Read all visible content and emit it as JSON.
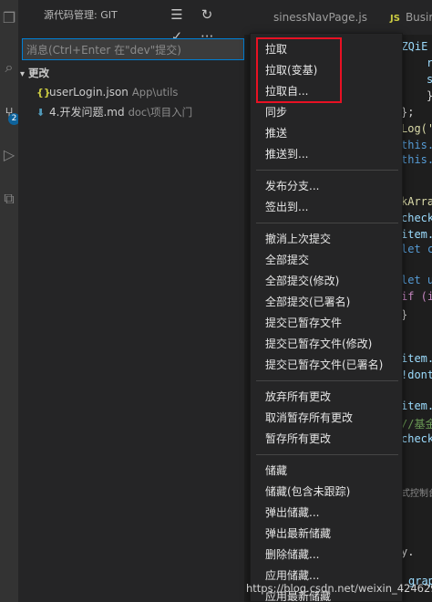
{
  "activity_badge": "2",
  "sidebar": {
    "title": "源代码管理: GIT",
    "commit_placeholder": "消息(Ctrl+Enter 在\"dev\"提交)",
    "group_label": "更改",
    "files": [
      {
        "icon": "{}",
        "name": "userLogin.json",
        "path": "App\\utils"
      },
      {
        "icon": "⬇",
        "name": "4.开发问题.md",
        "path": "doc\\项目入门"
      }
    ]
  },
  "tabs": [
    {
      "label": "sinessNavPage.js"
    },
    {
      "icon": "JS",
      "label": "Busir"
    }
  ],
  "editor": {
    "lines": [
      {
        "text": "ITZQiE",
        "color": "#9cdcfe"
      },
      {
        "text": "r",
        "color": "#9cdcfe"
      },
      {
        "text": "s",
        "color": "#9cdcfe"
      },
      {
        "text": "}",
        "color": "#d4d4d4"
      },
      {
        "text": "};",
        "color": "#d4d4d4"
      },
      {
        "text": "Log('",
        "color": "#dcdcaa"
      },
      {
        "text": "this.",
        "color": "#569cd6"
      },
      {
        "text": "this.",
        "color": "#569cd6"
      },
      {
        "text": "kArra",
        "color": "#dcdcaa"
      },
      {
        "text": "check",
        "color": "#9cdcfe"
      },
      {
        "text": "item.",
        "color": "#9cdcfe"
      },
      {
        "text": "let c",
        "color": "#569cd6"
      },
      {
        "text": "let u",
        "color": "#569cd6"
      },
      {
        "text": "if (i",
        "color": "#c586c0"
      },
      {
        "text": "}",
        "color": "#d4d4d4"
      },
      {
        "text": "item.",
        "color": "#9cdcfe"
      },
      {
        "text": "!dont",
        "color": "#9cdcfe"
      },
      {
        "text": "item.a",
        "color": "#9cdcfe"
      },
      {
        "text": "//基金",
        "color": "#6a9955"
      },
      {
        "text": "check",
        "color": "#9cdcfe"
      },
      {
        "text": "式控制台",
        "color": "#8c8c8c"
      },
      {
        "text": "y.",
        "color": "#d4d4d4"
      },
      {
        "text": "grap",
        "color": "#9cdcfe"
      }
    ]
  },
  "menu": {
    "groups": [
      [
        "拉取",
        "拉取(变基)",
        "拉取自...",
        "同步",
        "推送",
        "推送到..."
      ],
      [
        "发布分支...",
        "签出到..."
      ],
      [
        "撤消上次提交",
        "全部提交",
        "全部提交(修改)",
        "全部提交(已署名)",
        "提交已暂存文件",
        "提交已暂存文件(修改)",
        "提交已暂存文件(已署名)"
      ],
      [
        "放弃所有更改",
        "取消暂存所有更改",
        "暂存所有更改"
      ],
      [
        "储藏",
        "储藏(包含未跟踪)",
        "弹出储藏...",
        "弹出最新储藏",
        "删除储藏...",
        "应用储藏...",
        "应用最新储藏"
      ]
    ]
  },
  "watermark": "https://blog.csdn.net/weixin_42462981",
  "colors": {
    "highlight_box": "#e81123",
    "focus_border": "#007fd4",
    "badge": "#0e639c"
  }
}
